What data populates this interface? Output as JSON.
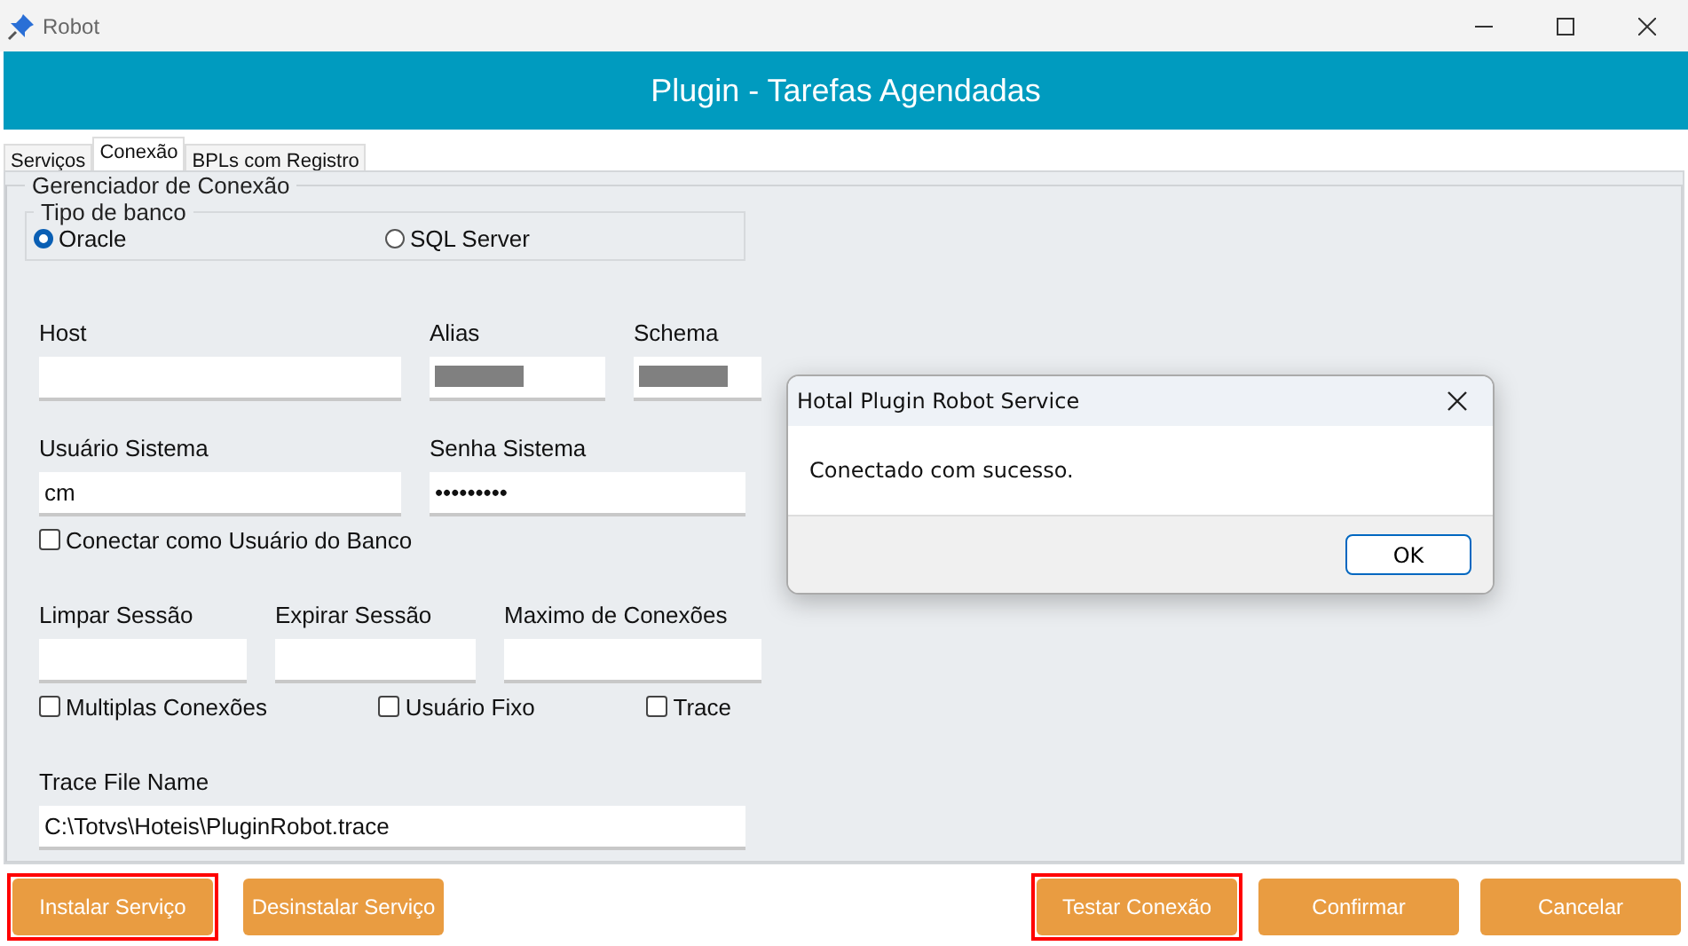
{
  "window": {
    "title": "Robot"
  },
  "header": {
    "title": "Plugin - Tarefas Agendadas"
  },
  "tabs": [
    {
      "label": "Serviços",
      "selected": false
    },
    {
      "label": "Conexão",
      "selected": true
    },
    {
      "label": "BPLs com Registro",
      "selected": false
    }
  ],
  "group": {
    "title": "Gerenciador de Conexão",
    "db_type": {
      "title": "Tipo de banco",
      "options": [
        {
          "label": "Oracle",
          "selected": true
        },
        {
          "label": "SQL Server",
          "selected": false
        }
      ]
    },
    "rows": [
      {
        "items": [
          {
            "kind": "field",
            "label": "Host"
          },
          {
            "kind": "field",
            "label": "Alias",
            "redacted": true
          },
          {
            "kind": "field",
            "label": "Schema",
            "redacted": true
          }
        ]
      },
      {
        "items": [
          {
            "kind": "field",
            "label": "Usuário Sistema",
            "value": "cm"
          },
          {
            "kind": "field",
            "label": "Senha Sistema",
            "value": "•••••••••"
          }
        ]
      },
      {
        "items": [
          {
            "kind": "checkbox",
            "label": "Conectar como Usuário do Banco",
            "checked": false
          }
        ]
      },
      {
        "items": [
          {
            "kind": "field",
            "label": "Limpar Sessão"
          },
          {
            "kind": "field",
            "label": "Expirar Sessão"
          },
          {
            "kind": "field",
            "label": "Maximo de Conexões"
          }
        ]
      },
      {
        "items": [
          {
            "kind": "checkbox",
            "label": "Multiplas Conexões",
            "checked": false
          },
          {
            "kind": "checkbox",
            "label": "Usuário Fixo",
            "checked": false
          },
          {
            "kind": "checkbox",
            "label": "Trace",
            "checked": false
          }
        ]
      },
      {
        "items": [
          {
            "kind": "field",
            "label": "Trace File Name",
            "value": "C:\\Totvs\\Hoteis\\PluginRobot.trace"
          }
        ]
      }
    ]
  },
  "footer": {
    "left_buttons": [
      {
        "label": "Instalar Serviço",
        "highlighted": true
      },
      {
        "label": "Desinstalar Serviço",
        "highlighted": false
      }
    ],
    "right_buttons": [
      {
        "label": "Testar Conexão",
        "highlighted": true
      },
      {
        "label": "Confirmar",
        "highlighted": false
      },
      {
        "label": "Cancelar",
        "highlighted": false
      }
    ]
  },
  "dialog": {
    "title": "Hotal Plugin Robot Service",
    "message": "Conectado com sucesso.",
    "button": "OK"
  }
}
